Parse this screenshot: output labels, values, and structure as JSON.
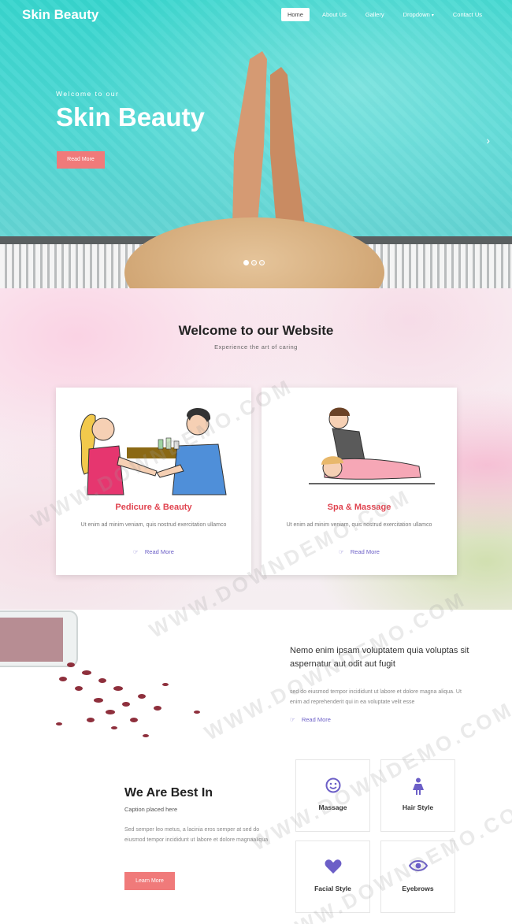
{
  "brand": "Skin Beauty",
  "nav": [
    "Home",
    "About Us",
    "Gallery",
    "Dropdown",
    "Contact Us"
  ],
  "hero": {
    "welcome": "Welcome to our",
    "title": "Skin Beauty",
    "button": "Read More",
    "arrow": "›",
    "slides": 3,
    "active_slide": 1
  },
  "welcome": {
    "title": "Welcome to our Website",
    "subtitle": "Experience the art of caring",
    "cards": [
      {
        "title": "Pedicure & Beauty",
        "text": "Ut enim ad minim veniam, quis nostrud exercitation ullamco",
        "link": "Read More"
      },
      {
        "title": "Spa & Massage",
        "text": "Ut enim ad minim veniam, quis nostrud exercitation ullamco",
        "link": "Read More"
      }
    ]
  },
  "about": {
    "title": "Nemo enim ipsam voluptatem quia voluptas sit aspernatur aut odit aut fugit",
    "text": "sed do eiusmod tempor incididunt ut labore et dolore magna aliqua. Ut enim ad reprehenderit qui in ea voluptate velit esse",
    "link": "Read More"
  },
  "best": {
    "title": "We Are Best In",
    "caption": "Caption placed here",
    "text": "Sed semper leo metus, a lacinia eros semper at sed do eiusmod tempor incididunt ut labore et dolore magnaaliqua",
    "button": "Learn More",
    "services": [
      {
        "label": "Massage",
        "icon": "smile-icon"
      },
      {
        "label": "Hair Style",
        "icon": "female-icon"
      },
      {
        "label": "Facial Style",
        "icon": "heart-icon"
      },
      {
        "label": "Eyebrows",
        "icon": "eye-icon"
      }
    ]
  },
  "watermark": "WWW.DOWNDEMO.COM",
  "colors": {
    "accent": "#f07a7a",
    "link": "#6c5fc7",
    "card_title": "#e0434f",
    "icon": "#6c5fc7",
    "hero_water": "#3fd6cf"
  }
}
